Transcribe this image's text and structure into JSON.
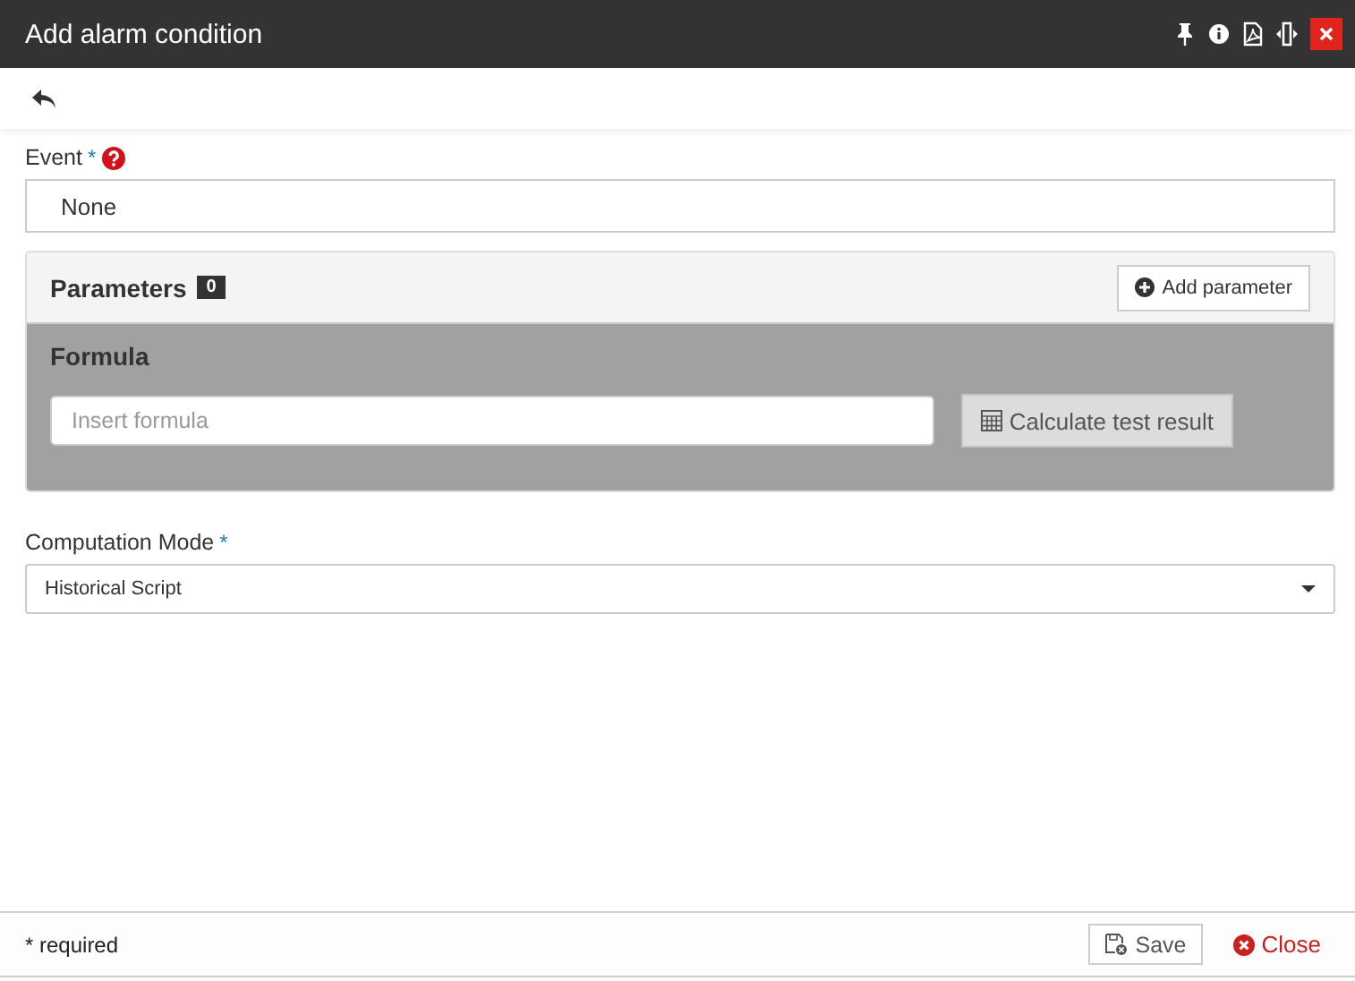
{
  "window": {
    "title": "Add alarm condition"
  },
  "event": {
    "label": "Event",
    "required_mark": "*",
    "value": "None"
  },
  "parameters": {
    "title": "Parameters",
    "count": "0",
    "add_button": "Add parameter"
  },
  "formula": {
    "title": "Formula",
    "placeholder": "Insert formula",
    "calculate_button": "Calculate test result"
  },
  "computation_mode": {
    "label": "Computation Mode",
    "required_mark": "*",
    "value": "Historical Script"
  },
  "footer": {
    "note": "* required",
    "save_button": "Save",
    "close_button": "Close"
  }
}
